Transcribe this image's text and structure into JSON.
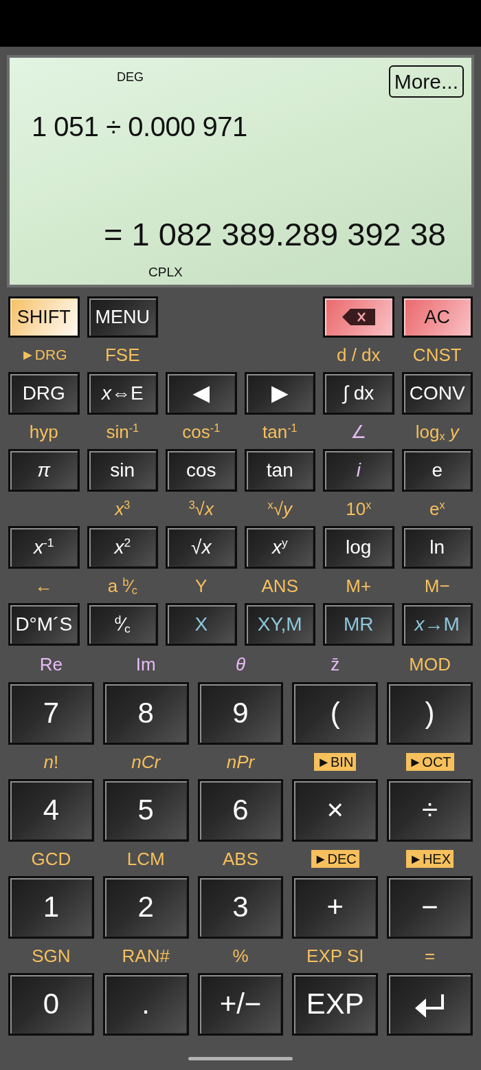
{
  "display": {
    "angle_mode": "DEG",
    "more_button": "More...",
    "expression": "1 051 ÷ 0.000 971",
    "result": "= 1 082 389.289 392 38",
    "complex_mode": "CPLX"
  },
  "top_row": {
    "left": [
      {
        "kind": "shift",
        "label": "SHIFT"
      },
      {
        "kind": "menu",
        "label": "MENU"
      }
    ],
    "right": [
      {
        "kind": "backspace"
      },
      {
        "kind": "clear",
        "label": "AC"
      }
    ]
  },
  "function_rows": [
    [
      {
        "label": "DRG",
        "kind": "plain",
        "above": {
          "text": "►DRG",
          "kind": "convert"
        }
      },
      {
        "label": "*x*⇔E",
        "kind": "plain",
        "above": {
          "text": "FSE",
          "kind": "shift"
        }
      },
      {
        "label": "◀",
        "kind": "cursor"
      },
      {
        "label": "▶",
        "kind": "cursor"
      },
      {
        "label": "∫ dx",
        "kind": "plain",
        "above": {
          "text": "d / dx",
          "kind": "shift"
        }
      },
      {
        "label": "CONV",
        "kind": "plain",
        "above": {
          "text": "CNST",
          "kind": "shift"
        }
      }
    ],
    [
      {
        "label": "π",
        "kind": "plain",
        "italic": true,
        "above": {
          "text": "hyp",
          "kind": "shift"
        }
      },
      {
        "label": "sin",
        "kind": "plain",
        "italic": false,
        "above": {
          "text": "sin$^{-1}$",
          "kind": "shift"
        }
      },
      {
        "label": "cos",
        "kind": "plain",
        "italic": false,
        "above": {
          "text": "cos$^{-1}$",
          "kind": "shift"
        }
      },
      {
        "label": "tan",
        "kind": "plain",
        "italic": false,
        "above": {
          "text": "tan$^{-1}$",
          "kind": "shift"
        }
      },
      {
        "label": "i",
        "kind": "complex",
        "italic": true,
        "above": {
          "text": "∠",
          "kind": "complex"
        }
      },
      {
        "label": "e",
        "kind": "plain",
        "italic": false,
        "above": {
          "text": "log$_{x}$ *y*",
          "kind": "shift"
        }
      }
    ],
    [
      {
        "label": "*x*$^{-1}$",
        "kind": "plain"
      },
      {
        "label": "*x*$^{2}$",
        "kind": "plain",
        "above": {
          "text": "*x*$^{3}$",
          "kind": "shift"
        }
      },
      {
        "label": "√*x*",
        "kind": "plain",
        "above": {
          "text": "$^{3}$√*x*",
          "kind": "shift"
        }
      },
      {
        "label": "*x*$^{y}$",
        "kind": "plain",
        "above": {
          "text": "$^{x}$√*y*",
          "kind": "shift"
        }
      },
      {
        "label": "log",
        "kind": "plain",
        "above": {
          "text": "10$^{x}$",
          "kind": "shift"
        }
      },
      {
        "label": "ln",
        "kind": "plain",
        "above": {
          "text": "e$^{x}$",
          "kind": "shift"
        }
      }
    ],
    [
      {
        "label": "D°M´S",
        "kind": "plain",
        "above": {
          "text": "←",
          "kind": "shift"
        }
      },
      {
        "label": "$^{d}$⁄$_{c}$",
        "kind": "plain",
        "above": {
          "text": "a $^{b}$⁄$_{c}$",
          "kind": "shift"
        }
      },
      {
        "label": "X",
        "kind": "memory",
        "above": {
          "text": "Y",
          "kind": "shift"
        }
      },
      {
        "label": "XY,M",
        "kind": "memory",
        "above": {
          "text": "ANS",
          "kind": "shift"
        }
      },
      {
        "label": "MR",
        "kind": "memory",
        "above": {
          "text": "M+",
          "kind": "shift"
        }
      },
      {
        "label": "*x*→M",
        "kind": "memory",
        "above": {
          "text": "M−",
          "kind": "shift"
        }
      }
    ]
  ],
  "number_rows": [
    [
      {
        "label": "7",
        "kind": "plain",
        "above": {
          "text": "Re",
          "kind": "complex",
          "italic": false
        }
      },
      {
        "label": "8",
        "kind": "plain",
        "above": {
          "text": "Im",
          "kind": "complex",
          "italic": false
        }
      },
      {
        "label": "9",
        "kind": "plain",
        "above": {
          "text": "θ",
          "kind": "complex",
          "italic": true
        }
      },
      {
        "label": "(",
        "kind": "plain",
        "above": {
          "text": "z̄",
          "kind": "complex",
          "italic": false
        }
      },
      {
        "label": ")",
        "kind": "plain",
        "above": {
          "text": "MOD",
          "kind": "shift",
          "italic": false
        }
      }
    ],
    [
      {
        "label": "4",
        "kind": "plain",
        "above": {
          "text": "*n*!",
          "kind": "shift",
          "italic": false
        }
      },
      {
        "label": "5",
        "kind": "plain",
        "above": {
          "text": "nCr",
          "kind": "shift",
          "italic": true
        }
      },
      {
        "label": "6",
        "kind": "plain",
        "above": {
          "text": "nPr",
          "kind": "shift",
          "italic": true
        }
      },
      {
        "label": "×",
        "kind": "plain",
        "above": {
          "text": "►BIN",
          "kind": "badge",
          "italic": false
        }
      },
      {
        "label": "÷",
        "kind": "plain",
        "above": {
          "text": "►OCT",
          "kind": "badge",
          "italic": false
        }
      }
    ],
    [
      {
        "label": "1",
        "kind": "plain",
        "above": {
          "text": "GCD",
          "kind": "shift"
        }
      },
      {
        "label": "2",
        "kind": "plain",
        "above": {
          "text": "LCM",
          "kind": "shift"
        }
      },
      {
        "label": "3",
        "kind": "plain",
        "above": {
          "text": "ABS",
          "kind": "shift"
        }
      },
      {
        "label": "+",
        "kind": "plain",
        "above": {
          "text": "►DEC",
          "kind": "badge"
        }
      },
      {
        "label": "−",
        "kind": "plain",
        "above": {
          "text": "►HEX",
          "kind": "badge"
        }
      }
    ],
    [
      {
        "label": "0",
        "kind": "plain",
        "above": {
          "text": "SGN",
          "kind": "shift"
        }
      },
      {
        "label": ".",
        "kind": "plain",
        "above": {
          "text": "RAN#",
          "kind": "shift"
        }
      },
      {
        "label": "+/−",
        "kind": "plain",
        "above": {
          "text": "%",
          "kind": "shift"
        }
      },
      {
        "label": "EXP",
        "kind": "plain",
        "above": {
          "text": "EXP SI",
          "kind": "shift"
        }
      },
      {
        "kind": "enter",
        "above": {
          "text": "=",
          "kind": "shift"
        }
      }
    ]
  ]
}
